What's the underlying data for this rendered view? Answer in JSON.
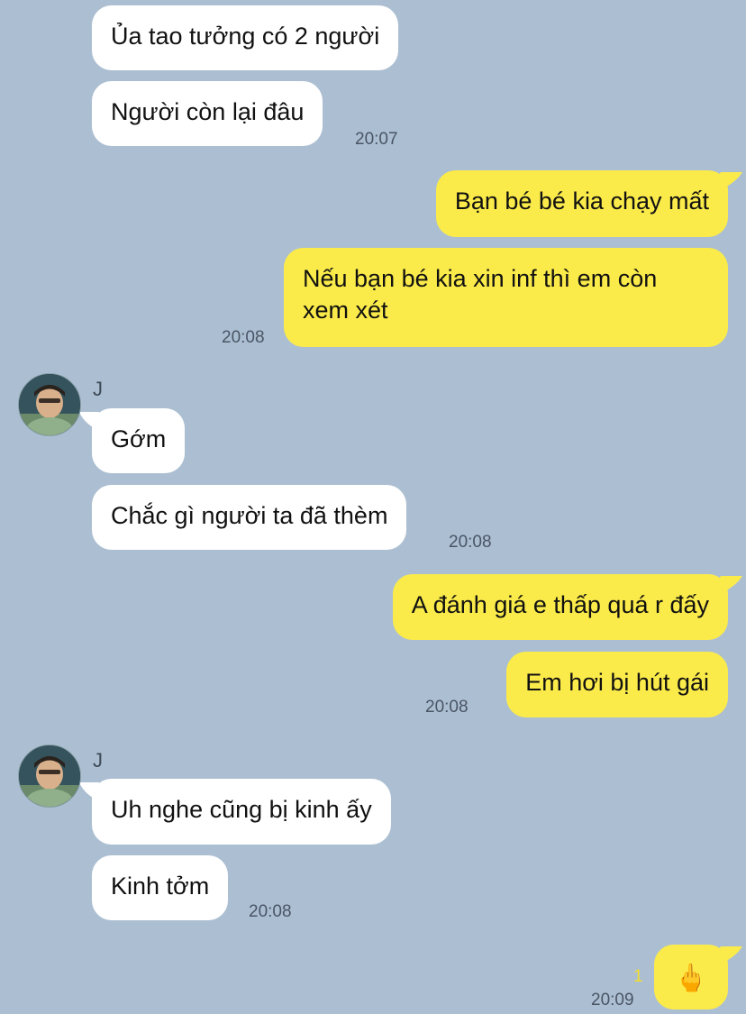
{
  "colors": {
    "background": "#acbfd2",
    "incoming_bubble": "#ffffff",
    "outgoing_bubble": "#fbeb4a",
    "timestamp": "#4a5565",
    "read_count": "#f3dd2a"
  },
  "messages": {
    "m1": "Ủa tao tưởng có 2 người",
    "m2": "Người còn lại đâu",
    "t1": "20:07",
    "m3": "Bạn bé bé kia chạy mất",
    "m4": "Nếu bạn bé kia xin inf thì em còn xem xét",
    "t2": "20:08",
    "sender1": "J",
    "m5": "Gớm",
    "m6": "Chắc gì người ta đã thèm",
    "t3": "20:08",
    "m7": "A đánh giá e thấp quá r đấy",
    "m8": "Em hơi bị hút gái",
    "t4": "20:08",
    "sender2": "J",
    "m9": "Uh nghe cũng bị kinh ấy",
    "m10": "Kinh tởm",
    "t5": "20:08",
    "m11_emoji": "🖕",
    "read_count": "1",
    "t6": "20:09"
  }
}
